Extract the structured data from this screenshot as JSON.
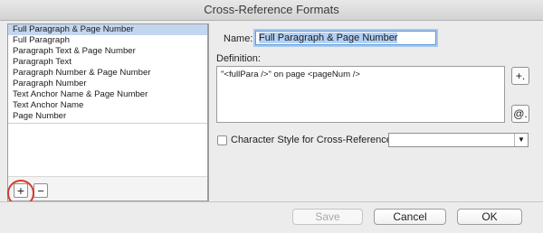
{
  "window": {
    "title": "Cross-Reference Formats"
  },
  "formats": [
    "Full Paragraph & Page Number",
    "Full Paragraph",
    "Paragraph Text & Page Number",
    "Paragraph Text",
    "Paragraph Number & Page Number",
    "Paragraph Number",
    "Text Anchor Name & Page Number",
    "Text Anchor Name",
    "Page Number"
  ],
  "selected_index": 0,
  "list_buttons": {
    "add": "+",
    "remove": "−"
  },
  "name": {
    "label": "Name:",
    "value": "Full Paragraph & Page Number"
  },
  "definition": {
    "label": "Definition:",
    "value": "\"<fullPara />\" on page <pageNum />"
  },
  "side_buttons": {
    "insert_building_block": "+.",
    "insert_special_char": "@."
  },
  "char_style": {
    "label": "Character Style for Cross-Reference:",
    "checked": false,
    "value": ""
  },
  "buttons": {
    "save": "Save",
    "cancel": "Cancel",
    "ok": "OK"
  },
  "colors": {
    "selection": "#c3d6ef",
    "focus": "#5b9bd8",
    "highlight_ring": "#d43b2d"
  }
}
